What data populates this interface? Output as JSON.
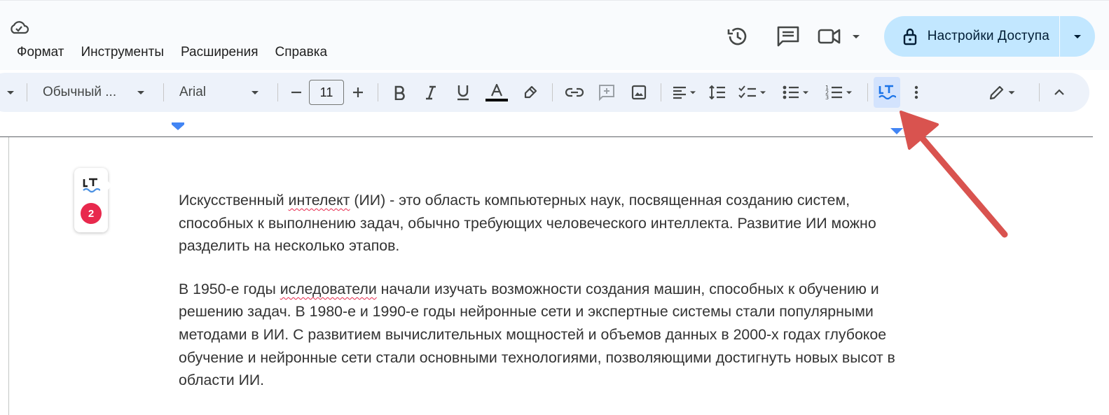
{
  "menu": [
    "Формат",
    "Инструменты",
    "Расширения",
    "Справка"
  ],
  "share": {
    "label": "Настройки Доступа"
  },
  "toolbar": {
    "style": "Обычный ...",
    "font": "Arial",
    "font_size": "11",
    "text_color": "#000000"
  },
  "addon": {
    "badge_count": "2"
  },
  "document": {
    "p1_pre": "Искусственный ",
    "p1_err": "интелект",
    "p1_post": " (ИИ) - это область компьютерных наук, посвященная созданию систем, способных к выполнению задач, обычно требующих человеческого интеллекта. Развитие ИИ можно разделить на несколько этапов.",
    "p2_pre": "В 1950-е годы ",
    "p2_err": "иследователи",
    "p2_post": " начали изучать возможности создания машин, способных к обучению и решению задач. В 1980-е и 1990-е годы нейронные сети и экспертные системы стали популярными методами в ИИ. С развитием вычислительных мощностей и объемов данных в 2000-х годах глубокое обучение и нейронные сети стали основными технологиями, позволяющими достигнуть новых высот в области ИИ."
  },
  "colors": {
    "accent": "#c2e7ff",
    "toolbar_bg": "#edf2fa",
    "error": "#e8294d",
    "annotation_arrow": "#d9534f"
  },
  "icons": [
    "cloud-icon",
    "history-icon",
    "comment-icon",
    "video-icon",
    "lock-icon",
    "bold-icon",
    "italic-icon",
    "underline-icon",
    "text-color-icon",
    "highlighter-icon",
    "link-icon",
    "add-comment-icon",
    "image-icon",
    "align-icon",
    "line-spacing-icon",
    "checklist-icon",
    "bullet-list-icon",
    "numbered-list-icon",
    "languagetool-icon",
    "more-icon",
    "edit-mode-icon",
    "collapse-icon"
  ]
}
